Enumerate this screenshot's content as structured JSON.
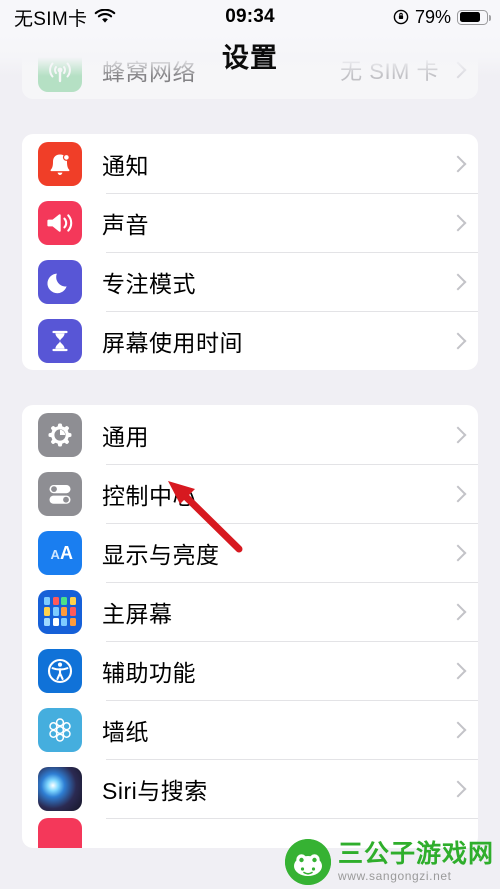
{
  "status_bar": {
    "carrier": "无SIM卡",
    "wifi_icon": "wifi-icon",
    "time": "09:34",
    "rotation_lock_icon": "rotation-lock-icon",
    "battery_percent": "79%",
    "battery_level": 79,
    "battery_icon": "battery-icon"
  },
  "nav": {
    "title": "设置"
  },
  "colors": {
    "page_background": "#f0eff4",
    "card_background": "#ffffff",
    "separator": "#e3e3e6",
    "chevron": "#c3c3c8",
    "value_text": "#8a8a8e",
    "annotation_arrow": "#d71920",
    "watermark_green": "#2fae2c"
  },
  "groups": [
    {
      "id": "group-connectivity",
      "faded": true,
      "rows": [
        {
          "id": "cellular",
          "label": "蜂窝网络",
          "value": "无 SIM 卡",
          "icon": "cellular-icon",
          "icon_color": "#6fd08c",
          "chevron": true
        }
      ]
    },
    {
      "id": "group-alerts",
      "faded": false,
      "rows": [
        {
          "id": "notifications",
          "label": "通知",
          "value": "",
          "icon": "bell-icon",
          "icon_color": "#f03e28",
          "chevron": true
        },
        {
          "id": "sounds",
          "label": "声音",
          "value": "",
          "icon": "speaker-icon",
          "icon_color": "#f4385a",
          "chevron": true
        },
        {
          "id": "focus",
          "label": "专注模式",
          "value": "",
          "icon": "moon-icon",
          "icon_color": "#5856d6",
          "chevron": true
        },
        {
          "id": "screen-time",
          "label": "屏幕使用时间",
          "value": "",
          "icon": "hourglass-icon",
          "icon_color": "#5856d6",
          "chevron": true
        }
      ]
    },
    {
      "id": "group-system",
      "faded": false,
      "rows": [
        {
          "id": "general",
          "label": "通用",
          "value": "",
          "icon": "gear-icon",
          "icon_color": "#8e8e93",
          "chevron": true
        },
        {
          "id": "control-center",
          "label": "控制中心",
          "value": "",
          "icon": "toggles-icon",
          "icon_color": "#8e8e93",
          "chevron": true
        },
        {
          "id": "display-brightness",
          "label": "显示与亮度",
          "value": "",
          "icon": "aa-icon",
          "icon_color": "#1a7ef0",
          "chevron": true
        },
        {
          "id": "home-screen",
          "label": "主屏幕",
          "value": "",
          "icon": "home-grid-icon",
          "icon_color": "#1660d8",
          "chevron": true
        },
        {
          "id": "accessibility",
          "label": "辅助功能",
          "value": "",
          "icon": "accessibility-icon",
          "icon_color": "#1072d8",
          "chevron": true
        },
        {
          "id": "wallpaper",
          "label": "墙纸",
          "value": "",
          "icon": "flower-icon",
          "icon_color": "#45aede",
          "chevron": true
        },
        {
          "id": "siri-search",
          "label": "Siri与搜索",
          "value": "",
          "icon": "siri-orb-icon",
          "icon_color": "#2b2a52",
          "chevron": true
        }
      ]
    }
  ],
  "annotation": {
    "arrow_icon": "red-pointer-arrow",
    "points_at": "general"
  },
  "watermark": {
    "title": "三公子游戏网",
    "url": "www.sangongzi.net",
    "logo_icon": "frog-mascot-icon"
  }
}
